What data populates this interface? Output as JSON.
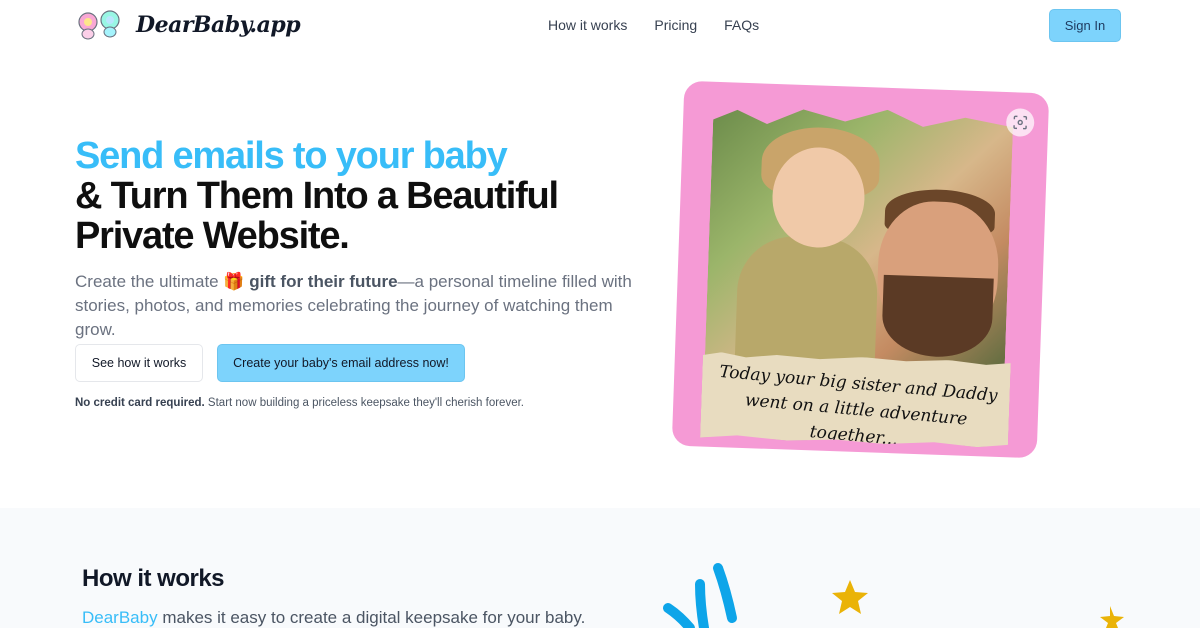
{
  "header": {
    "brand": "DearBaby.app",
    "nav": [
      {
        "label": "How it works"
      },
      {
        "label": "Pricing"
      },
      {
        "label": "FAQs"
      }
    ],
    "signin_label": "Sign In"
  },
  "hero": {
    "headline_blue": "Send emails to your baby",
    "headline_line2": "& Turn Them Into a Beautiful",
    "headline_line3": "Private Website.",
    "sub_pre": "Create the ultimate ",
    "sub_gift": "🎁",
    "sub_strong": "gift for their future",
    "sub_post": "—a personal timeline filled with stories, photos, and memories celebrating the journey of watching them grow.",
    "btn_secondary": "See how it works",
    "btn_primary": "Create your baby's email address now!",
    "note_strong": "No credit card required.",
    "note_rest": " Start now building a priceless keepsake they'll cherish forever."
  },
  "photo_card": {
    "caption": "Today your big sister and Daddy went on a little adventure together...",
    "accent": "#f59ad5"
  },
  "how_it_works": {
    "title": "How it works",
    "desc_brand": "DearBaby",
    "desc_rest": " makes it easy to create a digital keepsake for your baby."
  },
  "colors": {
    "accent_blue": "#38bdf8",
    "button_blue": "#7dd3fc",
    "pink": "#f59ad5"
  }
}
